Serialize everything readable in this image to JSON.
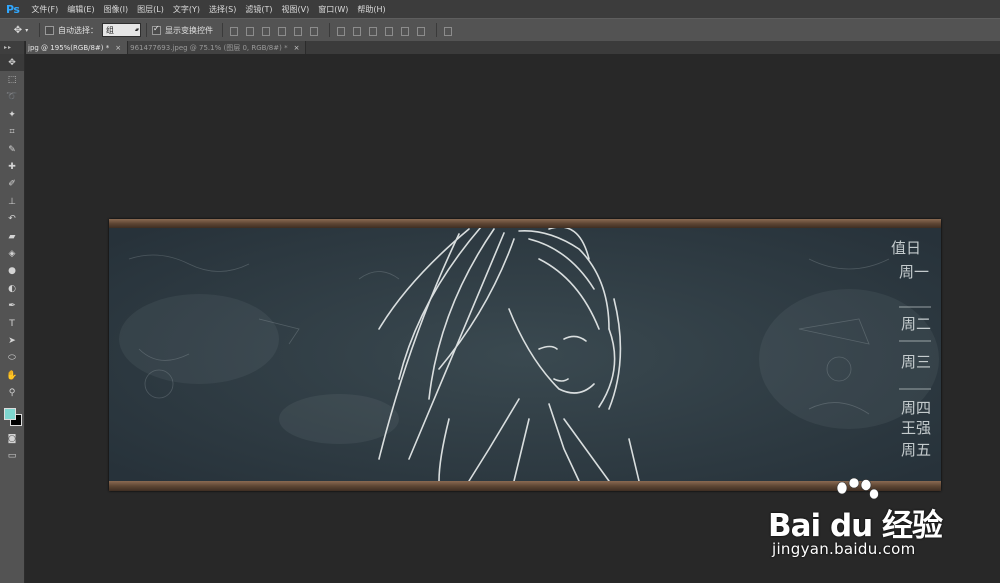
{
  "app": {
    "logo": "Ps"
  },
  "menu": [
    "文件(F)",
    "编辑(E)",
    "图像(I)",
    "图层(L)",
    "文字(Y)",
    "选择(S)",
    "滤镜(T)",
    "视图(V)",
    "窗口(W)",
    "帮助(H)"
  ],
  "options": {
    "auto_select_label": "自动选择：",
    "auto_select_checked": false,
    "auto_select_value": "组",
    "show_transform_label": "显示变换控件",
    "show_transform_checked": true
  },
  "tabs": [
    {
      "label": "jpg @ 195%(RGB/8#) *",
      "close": "×",
      "active": true
    },
    {
      "label": "961477693.jpeg @ 75.1% (图层 0, RGB/8#) *",
      "close": "×",
      "active": false
    }
  ],
  "toolbox": {
    "header": "▸▸",
    "tools": [
      "move-icon",
      "marquee-icon",
      "lasso-icon",
      "magic-wand-icon",
      "crop-icon",
      "eyedropper-icon",
      "healing-brush-icon",
      "brush-icon",
      "clone-stamp-icon",
      "history-brush-icon",
      "eraser-icon",
      "paint-bucket-icon",
      "blur-icon",
      "dodge-icon",
      "pen-icon",
      "type-icon",
      "path-select-icon",
      "ellipse-icon",
      "hand-icon",
      "zoom-icon"
    ],
    "foreground_color": "#7fd6cf",
    "background_color": "#000000"
  },
  "canvas": {
    "chalk_text": [
      "值日",
      "周一",
      "周二",
      "周三",
      "周四",
      "王强",
      "周五"
    ]
  },
  "watermark": {
    "brand": "Bai du 经验",
    "site": "jingyan.baidu.com"
  },
  "colors": {
    "board": "#2f3b42",
    "frame": "#6b5240",
    "chalk": "#e8ecec"
  }
}
